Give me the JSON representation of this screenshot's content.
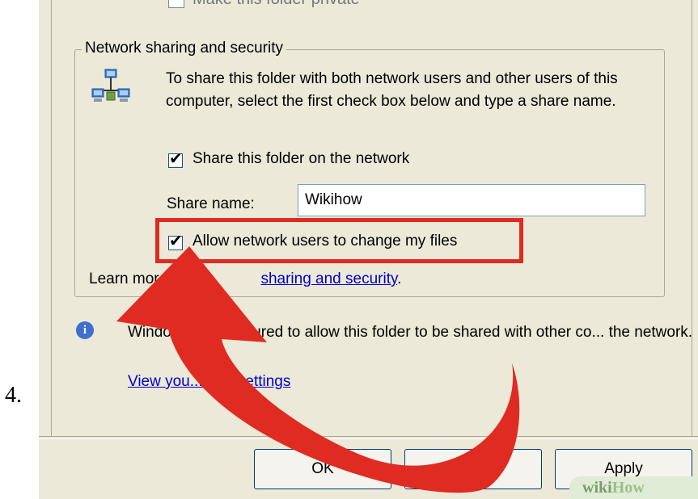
{
  "step_number": "4.",
  "private": {
    "label": "Make this folder private",
    "checked": false
  },
  "group": {
    "title": "Network sharing and security",
    "icon": "network-computers-icon"
  },
  "description": "To share this folder with both network users and other users of this computer, select the first check box below and type a share name.",
  "share_folder": {
    "label": "Share this folder on the network",
    "checked": true
  },
  "share_name": {
    "label": "Share name:",
    "value": "Wikihow"
  },
  "allow_change": {
    "label": "Allow network users to change my files",
    "checked": true
  },
  "learn_more": {
    "prefix": "Learn more",
    "link": "sharing and security",
    "suffix": "."
  },
  "info": {
    "text": "Windows ... configured to allow this folder to be shared with other co... the network.",
    "firewall_link": "View you... wall settings"
  },
  "buttons": {
    "ok": "OK",
    "apply": "Apply"
  },
  "watermark": {
    "wiki": "wiki",
    "how": "How"
  },
  "colors": {
    "dialog_bg": "#ece9d8",
    "highlight": "#e02b22",
    "link": "#0000c8"
  }
}
